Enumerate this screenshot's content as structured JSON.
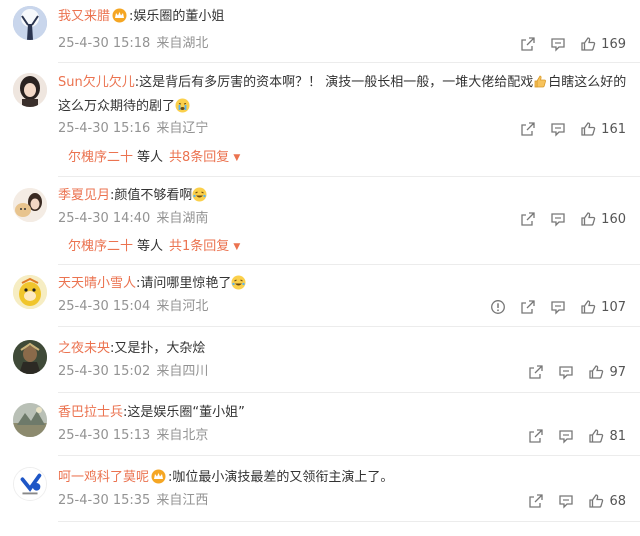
{
  "comments": [
    {
      "user": "我又来腊",
      "text": ":娱乐圈的董小姐",
      "time": "25-4-30 15:18",
      "location": "来自湖北",
      "likes": "169",
      "has_crown": true
    },
    {
      "user": "Sun欠儿欠儿",
      "text_a": ":这是背后有多厉害的资本啊？！ 演技一般长相一般，一堆大佬给配戏",
      "text_b": "白瞎这么好的这么万众期待的剧了",
      "time": "25-4-30 15:16",
      "location": "来自辽宁",
      "likes": "161",
      "replies": {
        "user": "尔槐序二十",
        "mid": "等人",
        "count": "共8条回复"
      }
    },
    {
      "user": "季夏见月",
      "text": ":颜值不够看啊",
      "time": "25-4-30 14:40",
      "location": "来自湖南",
      "likes": "160",
      "replies": {
        "user": "尔槐序二十",
        "mid": "等人",
        "count": "共1条回复"
      }
    },
    {
      "user": "天天晴小雪人",
      "text": ":请问哪里惊艳了",
      "time": "25-4-30 15:04",
      "location": "来自河北",
      "likes": "107"
    },
    {
      "user": "之夜未央",
      "text": ":又是扑，大杂烩",
      "time": "25-4-30 15:02",
      "location": "来自四川",
      "likes": "97"
    },
    {
      "user": "香巴拉士兵",
      "text": ":这是娱乐圈“董小姐”",
      "time": "25-4-30 15:13",
      "location": "来自北京",
      "likes": "81"
    },
    {
      "user": "呵一鸡科了莫呢",
      "text": ":咖位最小演技最差的又领衔主演上了。",
      "time": "25-4-30 15:35",
      "location": "来自江西",
      "likes": "68",
      "has_crown": true
    }
  ],
  "colors": {
    "username": "#eb7350",
    "meta": "#939393",
    "text": "#333333",
    "divider": "#ececec"
  },
  "icons": [
    "share-icon",
    "comment-icon",
    "like-icon",
    "report-icon",
    "crown-icon",
    "emoji-icon",
    "reply-expand-arrow-icon"
  ]
}
